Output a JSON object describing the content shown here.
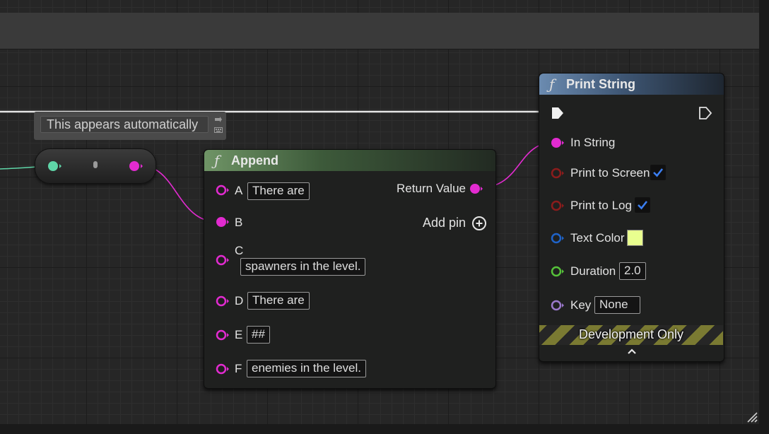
{
  "colors": {
    "string_pin": "#e22bd0",
    "bool_pin": "#8b1c1c",
    "linear_color_pin": "#1f63c8",
    "float_pin": "#56c23a",
    "name_pin": "#9b79cc",
    "wildcard_pin": "#5fd6a8",
    "text_color_swatch": "#e9ff8f",
    "checkbox_check": "#3b7ef0"
  },
  "tooltip": {
    "text": "This appears automatically"
  },
  "append_node": {
    "title": "Append",
    "function_icon": "ƒ",
    "inputs": [
      {
        "name": "A",
        "value": "There are"
      },
      {
        "name": "B",
        "value": ""
      },
      {
        "name": "C",
        "value": "spawners in the level."
      },
      {
        "name": "D",
        "value": "There are"
      },
      {
        "name": "E",
        "value": "##"
      },
      {
        "name": "F",
        "value": "enemies in the level."
      }
    ],
    "output_label": "Return Value",
    "add_pin_label": "Add pin"
  },
  "print_node": {
    "title": "Print String",
    "function_icon": "ƒ",
    "in_string_label": "In String",
    "print_to_screen_label": "Print to Screen",
    "print_to_screen": true,
    "print_to_log_label": "Print to Log",
    "print_to_log": true,
    "text_color_label": "Text Color",
    "duration_label": "Duration",
    "duration_value": "2.0",
    "key_label": "Key",
    "key_value": "None",
    "dev_only_label": "Development Only"
  }
}
